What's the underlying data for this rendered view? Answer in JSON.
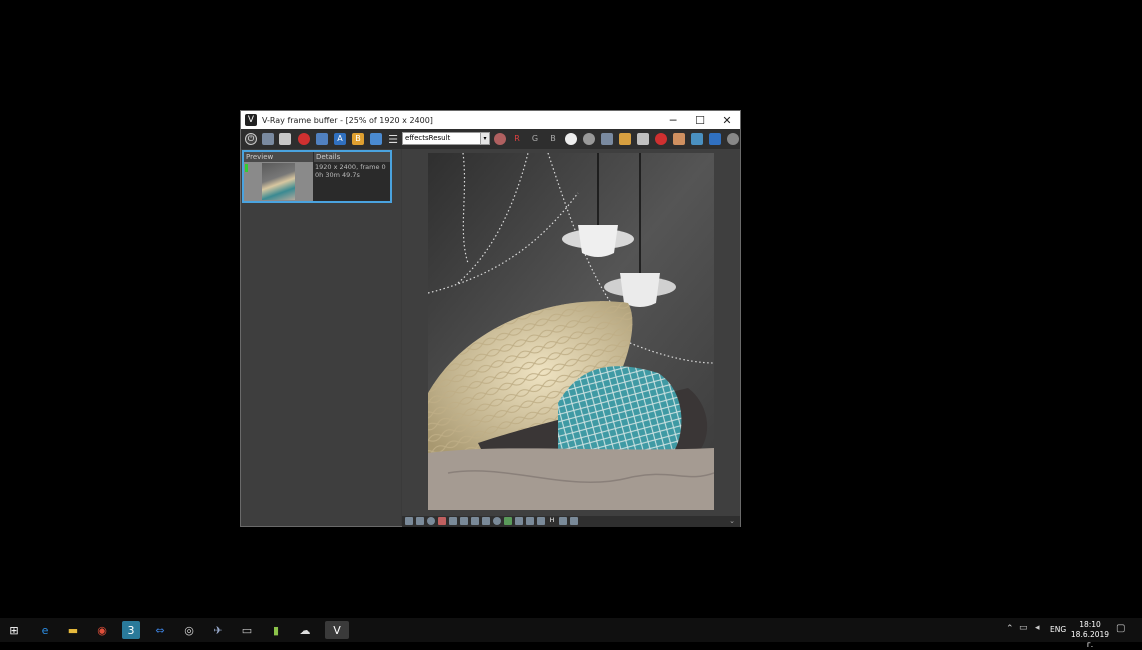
{
  "window": {
    "title": "V-Ray frame buffer - [25% of 1920 x 2400]",
    "controls": {
      "minimize": "─",
      "maximize": "☐",
      "close": "✕"
    }
  },
  "toolbar": {
    "channel": "effectsResult",
    "channel_arrow": "▾",
    "r_label": "R",
    "g_label": "G",
    "b_label": "B",
    "menu_glyph": "☰"
  },
  "history": {
    "preview_label": "Preview",
    "details_label": "Details",
    "details_line1": "1920 x 2400, frame 0",
    "details_line2": "0h 30m 49.7s"
  },
  "bottombar": {
    "h_label": "H"
  },
  "taskbar": {
    "lang": "ENG",
    "time": "18:10",
    "date": "18.6.2019 г."
  }
}
